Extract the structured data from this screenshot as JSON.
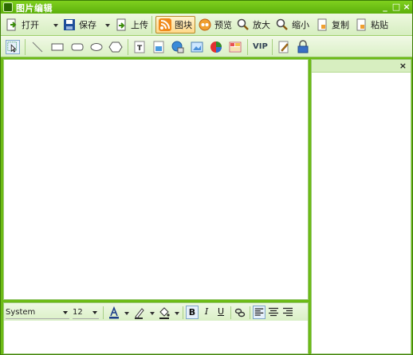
{
  "window": {
    "title": "图片编辑",
    "controls": [
      "_",
      "□",
      "×"
    ]
  },
  "toolbar": {
    "open_label": "打开",
    "save_label": "保存",
    "upload_label": "上传",
    "block_label": "图块",
    "preview_label": "预览",
    "zoom_in_label": "放大",
    "zoom_out_label": "缩小",
    "copy_label": "复制",
    "paste_label": "粘贴"
  },
  "drawtools": {
    "vip_label": "VIP"
  },
  "side_panel": {
    "close_label": "×"
  },
  "format": {
    "font_family": "System",
    "font_size": "12",
    "bold_label": "B",
    "italic_label": "I",
    "underline_label": "U"
  },
  "colors": {
    "window_green": "#6dbb16",
    "toolbar_bg": "#e6f4d6",
    "active_button": "#ffd98a"
  }
}
